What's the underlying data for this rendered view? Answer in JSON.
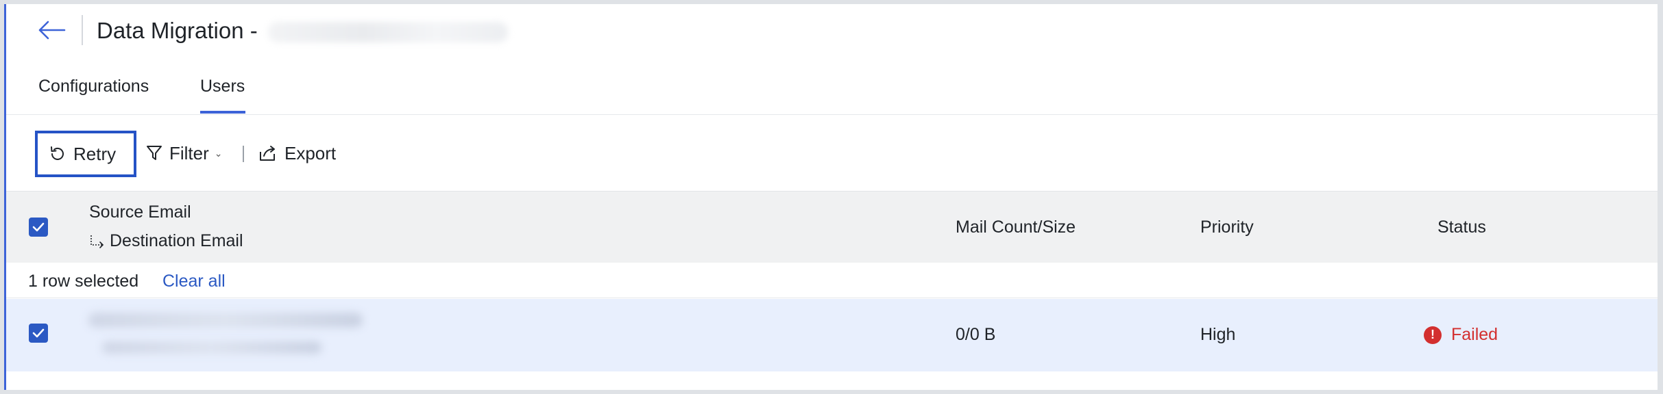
{
  "header": {
    "title": "Data Migration -"
  },
  "tabs": [
    {
      "label": "Configurations",
      "active": false
    },
    {
      "label": "Users",
      "active": true
    }
  ],
  "toolbar": {
    "retry_label": "Retry",
    "filter_label": "Filter",
    "export_label": "Export"
  },
  "table": {
    "columns": {
      "source_email": "Source Email",
      "destination_email": "Destination Email",
      "mail_count_size": "Mail Count/Size",
      "priority": "Priority",
      "status": "Status"
    },
    "selection": {
      "count_text": "1 row selected",
      "clear_label": "Clear all"
    },
    "rows": [
      {
        "selected": true,
        "mail_count_size": "0/0 B",
        "priority": "High",
        "status": "Failed"
      }
    ]
  },
  "colors": {
    "accent": "#3d63d8",
    "checkbox": "#2b59c3",
    "failed": "#d32f2f",
    "row_selected_bg": "#e8effd",
    "header_bg": "#f0f1f2"
  },
  "icons": {
    "back": "arrow-left-icon",
    "retry": "retry-icon",
    "filter": "filter-icon",
    "export": "export-icon",
    "status_failed": "exclamation-circle-icon"
  }
}
